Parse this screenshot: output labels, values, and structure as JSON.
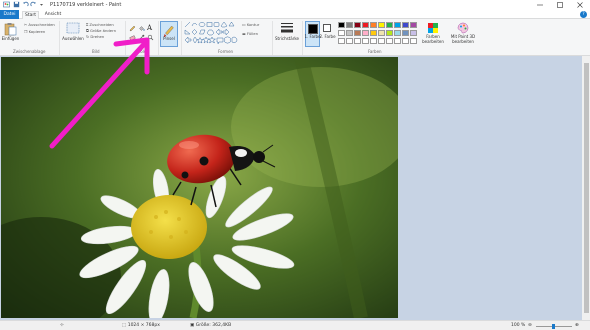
{
  "window": {
    "title": "P1170719 verkleinert - Paint",
    "minimize_icon": "minimize-icon",
    "maximize_icon": "maximize-icon",
    "close_icon": "close-icon"
  },
  "tabs": {
    "file": "Datei",
    "start": "Start",
    "view": "Ansicht"
  },
  "ribbon": {
    "clipboard": {
      "paste": "Einfügen",
      "cut": "Ausschneiden",
      "copy": "Kopieren",
      "group": "Zwischenablage"
    },
    "image": {
      "select": "Auswählen",
      "crop": "Zuschneiden",
      "resize": "Größe ändern",
      "rotate": "Drehen",
      "group": "Bild"
    },
    "tools": {
      "group": "Tools"
    },
    "brushes": {
      "label": "Pinsel"
    },
    "shapes": {
      "outline": "Kontur",
      "fill": "Füllen",
      "group": "Formen"
    },
    "size": {
      "label": "Strichstärke"
    },
    "colors": {
      "color1": "1. Farbe",
      "color2": "2. Farbe",
      "edit": "Farben bearbeiten",
      "paint3d": "Mit Paint 3D bearbeiten",
      "group": "Farben",
      "color1_value": "#000000",
      "color2_value": "#ffffff",
      "palette_row1": [
        "#000000",
        "#7f7f7f",
        "#880015",
        "#ed1c24",
        "#ff7f27",
        "#fff200",
        "#22b14c",
        "#00a2e8",
        "#3f48cc",
        "#a349a4"
      ],
      "palette_row2": [
        "#ffffff",
        "#c3c3c3",
        "#b97a57",
        "#ffaec9",
        "#ffc90e",
        "#efe4b0",
        "#b5e61d",
        "#99d9ea",
        "#7092be",
        "#c8bfe7"
      ],
      "palette_row3": [
        "#ffffff",
        "#ffffff",
        "#ffffff",
        "#ffffff",
        "#ffffff",
        "#ffffff",
        "#ffffff",
        "#ffffff",
        "#ffffff",
        "#ffffff"
      ]
    }
  },
  "status": {
    "dimensions": "1024 × 768px",
    "filesize": "Größe: 362,4KB",
    "zoom": "100 %",
    "zoom_level": 1.0
  },
  "annotation": {
    "arrow_color": "#f01ec8"
  },
  "canvas": {
    "image_subject": "ladybug-on-daisy"
  }
}
